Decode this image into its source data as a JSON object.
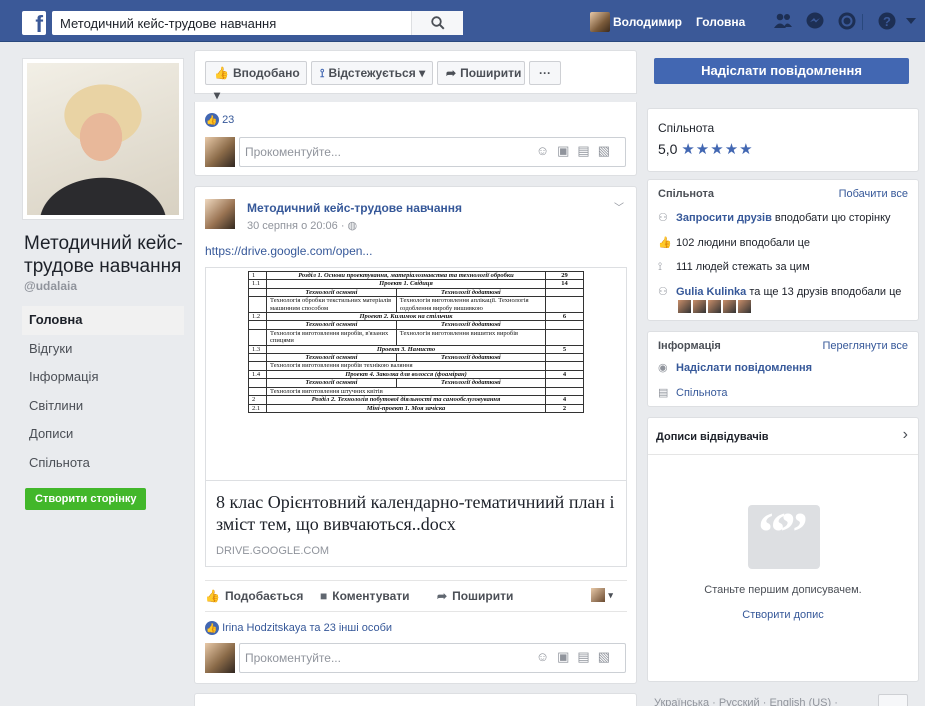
{
  "topbar": {
    "logo_letter": "f",
    "search_value": "Методичний кейс-трудове навчання",
    "user_name": "Володимир",
    "home_label": "Головна",
    "icons": [
      "friends-icon",
      "messenger-icon",
      "notifications-icon",
      "help-icon",
      "dropdown-icon"
    ]
  },
  "page": {
    "name": "Методичний кейс-трудове навчання",
    "handle": "@udalaia",
    "nav": [
      {
        "label": "Головна",
        "active": true
      },
      {
        "label": "Відгуки"
      },
      {
        "label": "Інформація"
      },
      {
        "label": "Світлини"
      },
      {
        "label": "Дописи"
      },
      {
        "label": "Спільнота"
      }
    ],
    "create_page_label": "Створити сторінку"
  },
  "action_bar": {
    "liked_label": "Вподобано",
    "following_label": "Відстежується",
    "share_label": "Поширити",
    "more_label": "···"
  },
  "post_top": {
    "likes_count": "23",
    "comment_placeholder": "Прокоментуйте..."
  },
  "post": {
    "author": "Методичний кейс-трудове навчання",
    "time": "30 серпня о 20:06 · ",
    "link_text": "https://drive.google.com/open...",
    "attachment": {
      "title": "8 клас Орієнтовний календарно-тематичниий план і зміст тем, що вивчаються..docx",
      "domain": "DRIVE.GOOGLE.COM",
      "doc_rows": [
        [
          "1",
          "Розділ 1. Основи проектування, матеріалознавства та технології обробки",
          "29"
        ],
        [
          "1.1",
          "Проект 1. Свідиця",
          "14"
        ],
        [
          "",
          "Технології основні | Технології додаткові",
          ""
        ],
        [
          "",
          "Технологія обробки текстильних матеріалів машинним способом | Технологія виготовлення аплікації. Технологія оздоблення виробу вишивкою",
          ""
        ],
        [
          "1.2",
          "Проект 2. Килимок на стільчик",
          "6"
        ],
        [
          "",
          "Технології основні | Технології додаткові",
          ""
        ],
        [
          "",
          "Технологія виготовлення виробів, в'язаних спицями | Технологія виготовлення вишитих виробів",
          ""
        ],
        [
          "1.3",
          "Проект 3. Намисто",
          "5"
        ],
        [
          "",
          "Технології основні | Технології додаткові",
          ""
        ],
        [
          "",
          "Технологія виготовлення виробів технікою валяння",
          ""
        ],
        [
          "1.4",
          "Проект 4. Заколка для волосся (фоаміран)",
          "4"
        ],
        [
          "",
          "Технології основні | Технології додаткові",
          ""
        ],
        [
          "",
          "Технологія виготовлення штучних квітів",
          ""
        ],
        [
          "2",
          "Розділ 2. Технологія побутової діяльності та самообслуговування",
          "4"
        ],
        [
          "2.1",
          "Міні-проект 1. Моя зачіска",
          "2"
        ]
      ]
    },
    "actions": {
      "like": "Подобається",
      "comment": "Коментувати",
      "share": "Поширити"
    },
    "likes_text": "Irina Hodzitskaya та 23 інші особи",
    "comment_placeholder": "Прокоментуйте..."
  },
  "sidebar": {
    "send_message": "Надіслати повідомлення",
    "rating": {
      "label": "Спільнота",
      "value": "5,0",
      "stars": "★★★★★"
    },
    "community": {
      "title": "Спільнота",
      "see_all": "Побачити все",
      "invite_link": "Запросити друзів",
      "invite_rest": " вподобати цю сторінку",
      "likes_text": "102 людини вподобали це",
      "follows_text": "111 людей стежать за цим",
      "friend_name": "Gulia Kulinka",
      "friend_rest": " та ще 13 друзів вподобали це"
    },
    "info": {
      "title": "Інформація",
      "see_all": "Переглянути все",
      "send_message": "Надіслати повідомлення",
      "community": "Спільнота"
    },
    "visitors": {
      "title": "Дописи відвідувачів",
      "quote": "“”",
      "empty_text": "Станьте першим дописувачем.",
      "create_link": "Створити допис"
    },
    "languages": "Українська · Русский · English (US) ·"
  },
  "colors": {
    "brand": "#3b5998",
    "primary_button": "#4267b2",
    "create_button": "#42b72a",
    "link": "#365899"
  }
}
